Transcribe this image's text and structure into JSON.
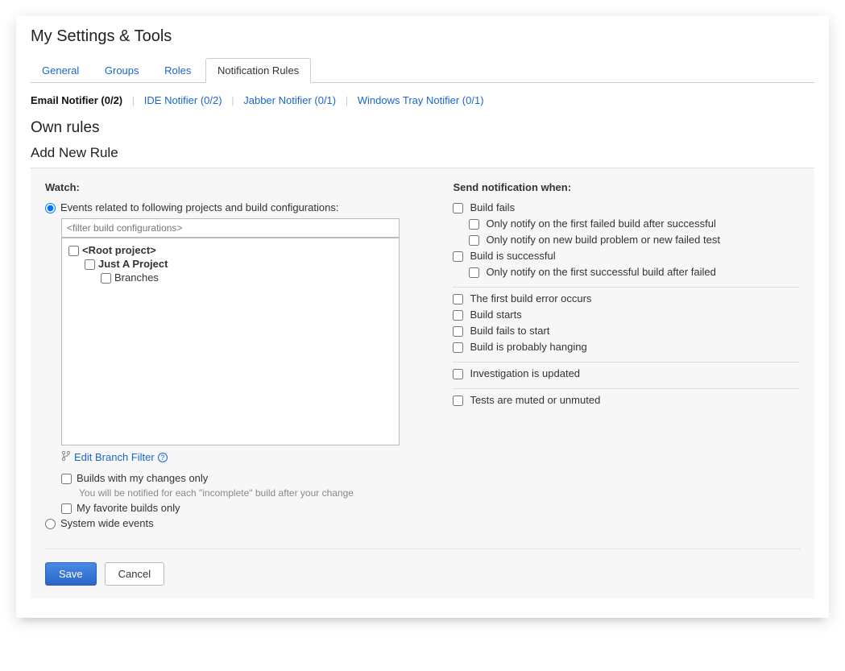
{
  "page_title": "My Settings & Tools",
  "tabs": {
    "general": "General",
    "groups": "Groups",
    "roles": "Roles",
    "notification_rules": "Notification Rules"
  },
  "sub_nav": {
    "email": "Email Notifier (0/2)",
    "ide": "IDE Notifier (0/2)",
    "jabber": "Jabber Notifier (0/1)",
    "tray": "Windows Tray Notifier (0/1)"
  },
  "section_own_rules": "Own rules",
  "section_add_rule": "Add New Rule",
  "watch": {
    "heading": "Watch:",
    "events_label": "Events related to following projects and build configurations:",
    "filter_placeholder": "<filter build configurations>",
    "tree": {
      "root": "<Root project>",
      "project": "Just A Project",
      "branches": "Branches"
    },
    "branch_filter": "Edit Branch Filter",
    "builds_changes": "Builds with my changes only",
    "builds_changes_hint": "You will be notified for each \"incomplete\" build after your change",
    "favorite_builds": "My favorite builds only",
    "system_events": "System wide events"
  },
  "notify": {
    "heading": "Send notification when:",
    "build_fails": "Build fails",
    "first_failed_after_success": "Only notify on the first failed build after successful",
    "new_problem_or_test": "Only notify on new build problem or new failed test",
    "build_successful": "Build is successful",
    "first_success_after_failed": "Only notify on the first successful build after failed",
    "first_error": "The first build error occurs",
    "build_starts": "Build starts",
    "fails_to_start": "Build fails to start",
    "probably_hanging": "Build is probably hanging",
    "investigation_updated": "Investigation is updated",
    "tests_muted": "Tests are muted or unmuted"
  },
  "buttons": {
    "save": "Save",
    "cancel": "Cancel"
  }
}
